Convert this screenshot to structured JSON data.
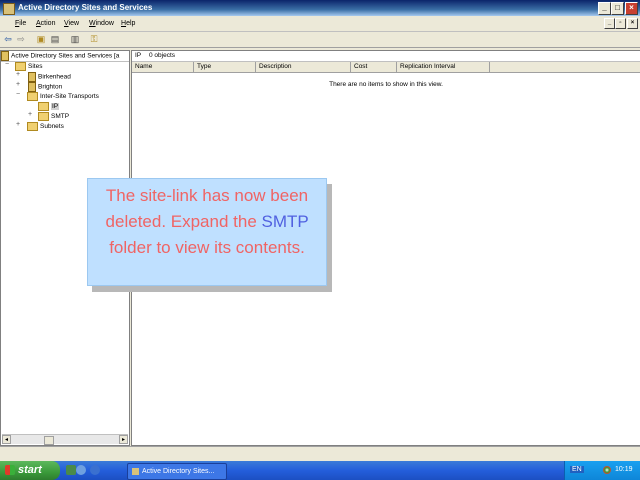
{
  "window": {
    "title": "Active Directory Sites and Services",
    "buttons": {
      "minimize": "_",
      "maximize": "□",
      "close": "×"
    }
  },
  "menu": [
    "File",
    "Action",
    "View",
    "Window",
    "Help"
  ],
  "toolbar": {
    "icons": [
      "back-icon",
      "forward-icon",
      "up-icon",
      "show-hide-tree-icon",
      "export-list-icon",
      "help-icon"
    ]
  },
  "tree": {
    "header": "Active Directory Sites and Services [a",
    "nodes": {
      "sites": "Sites",
      "birkenhead": "Birkenhead",
      "brighton": "Brighton",
      "inter_site": "Inter-Site Transports",
      "ip": "IP",
      "smtp": "SMTP",
      "subnets": "Subnets"
    }
  },
  "list": {
    "location": "IP",
    "count": "0 objects",
    "columns": [
      "Name",
      "Type",
      "Description",
      "Cost",
      "Replication Interval"
    ],
    "empty_message": "There are no items to show in this view."
  },
  "callout": {
    "text_before": "The site-link has now been deleted. Expand the ",
    "highlight": "SMTP",
    "text_after": " folder to view its contents.",
    "text_color": "#f06464",
    "highlight_color": "#5060e0",
    "background": "#bfe0ff"
  },
  "taskbar": {
    "start_label": "start",
    "task_label": "Active Directory Sites...",
    "language": "EN",
    "clock": "10:19"
  }
}
